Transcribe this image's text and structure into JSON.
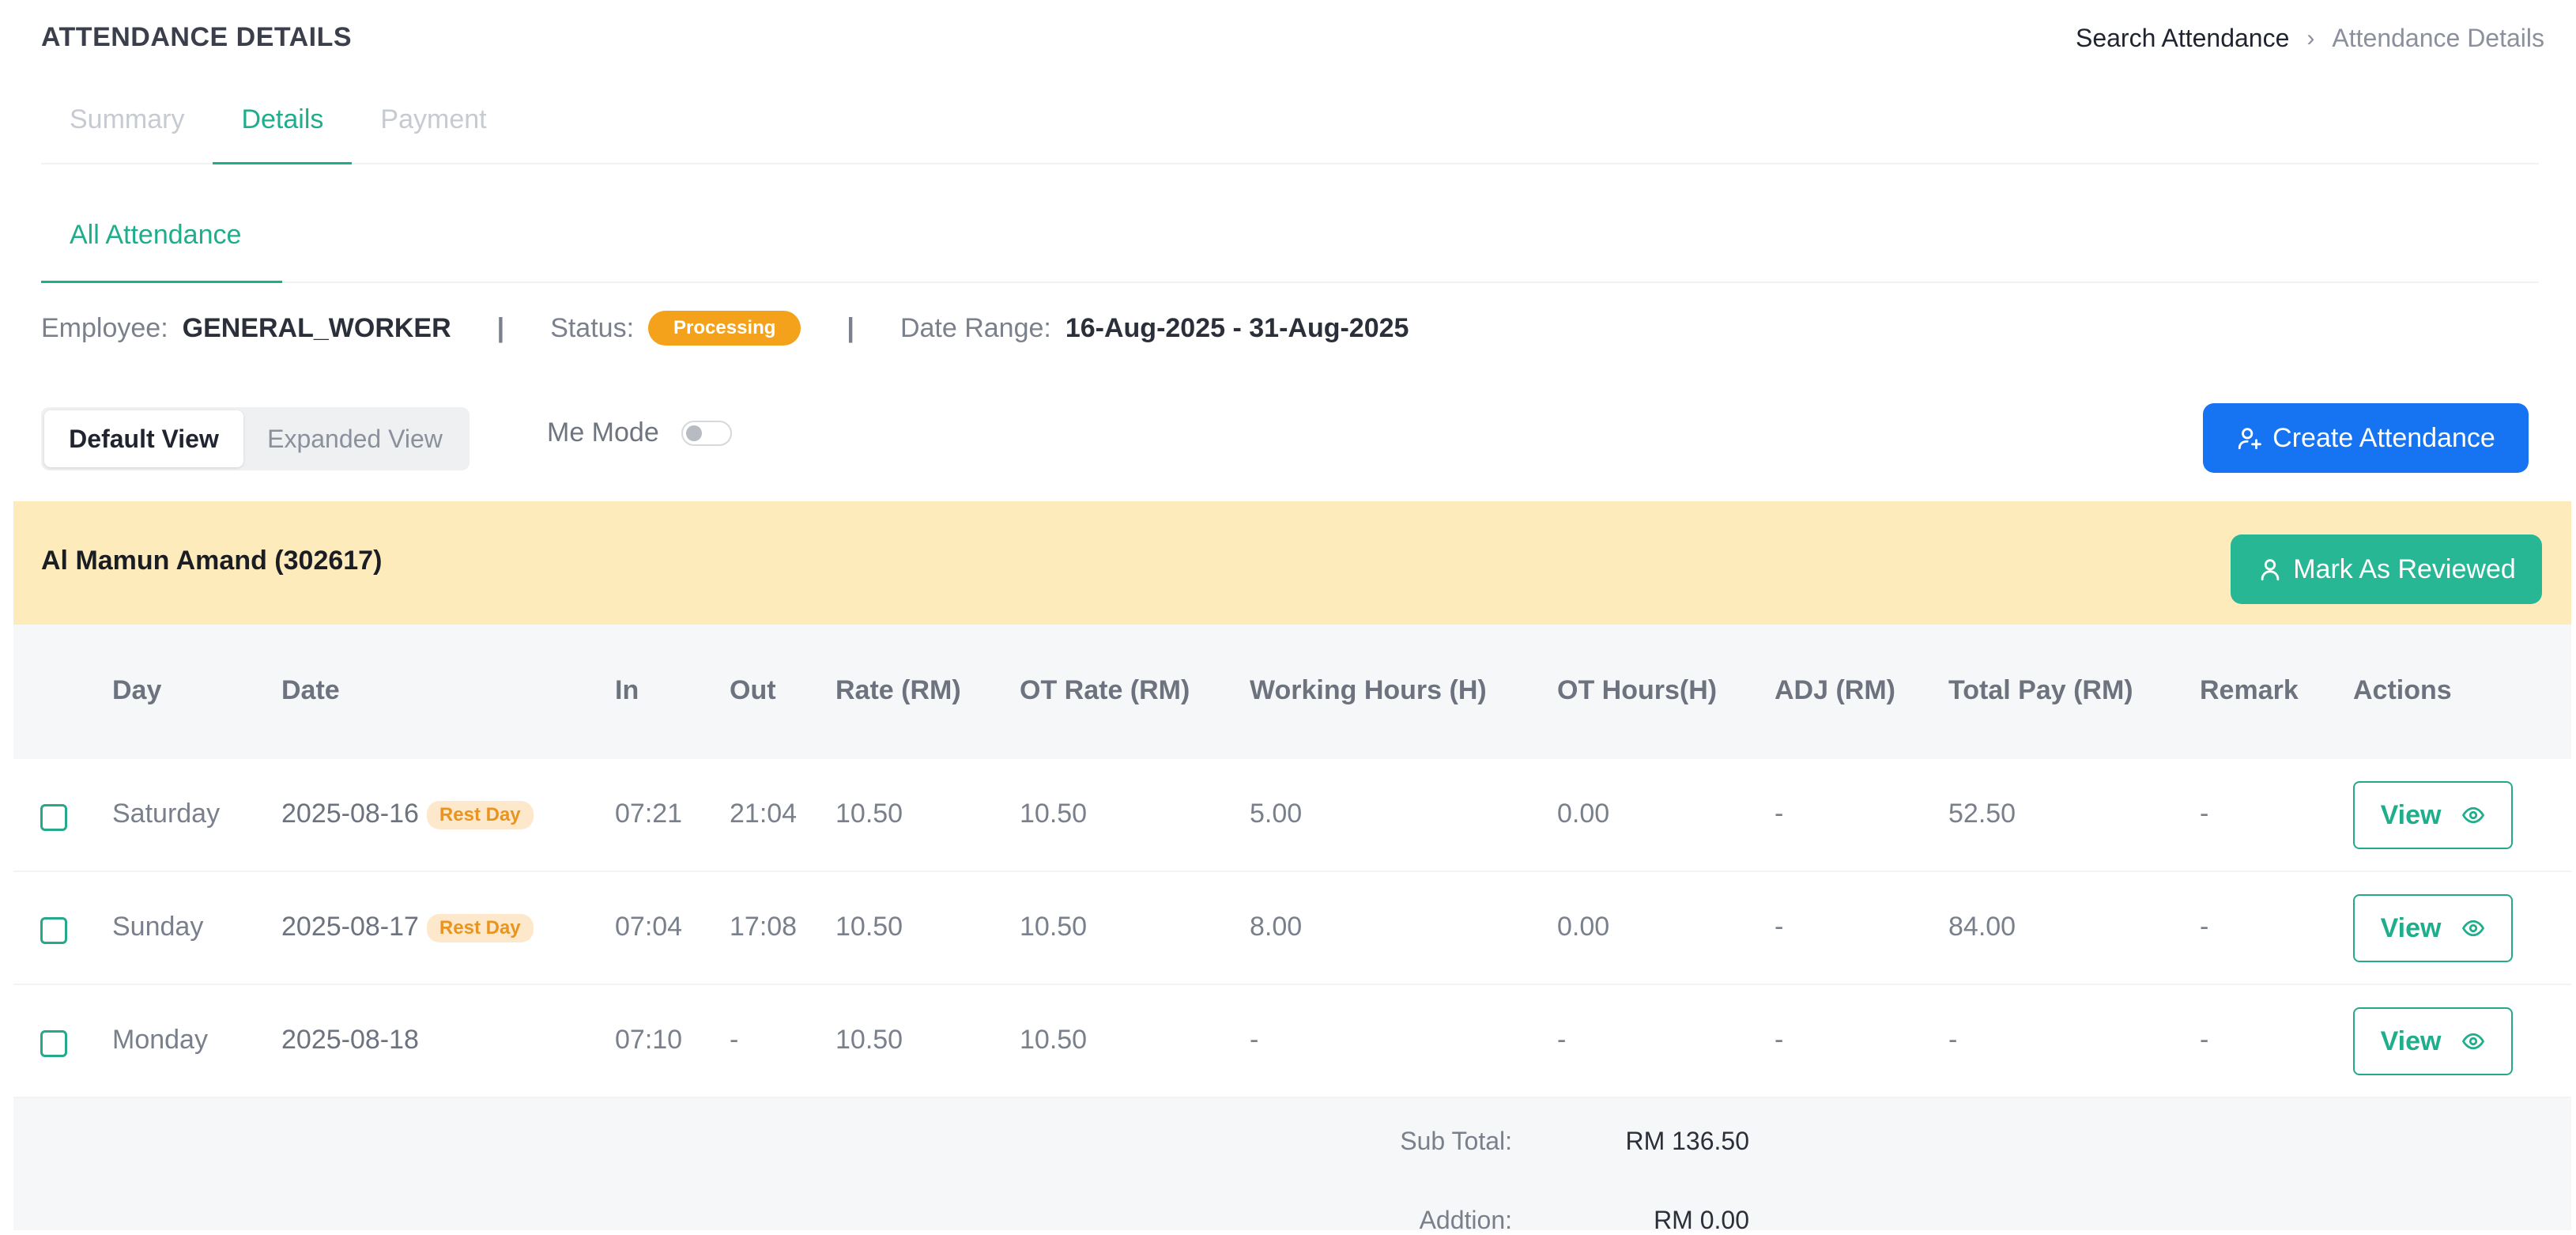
{
  "header": {
    "title": "ATTENDANCE DETAILS",
    "breadcrumb": {
      "parent": "Search Attendance",
      "separator": "›",
      "current": "Attendance Details"
    }
  },
  "tabs": [
    {
      "label": "Summary",
      "active": false
    },
    {
      "label": "Details",
      "active": true
    },
    {
      "label": "Payment",
      "active": false
    }
  ],
  "subtabs": {
    "all_attendance": "All Attendance"
  },
  "info": {
    "employee_label": "Employee:",
    "employee_value": "GENERAL_WORKER",
    "sep": "|",
    "status_label": "Status:",
    "status_value": "Processing",
    "date_range_label": "Date Range:",
    "date_range_value": "16-Aug-2025 - 31-Aug-2025"
  },
  "view_toggle": {
    "default": "Default View",
    "expanded": "Expanded View",
    "selected": "Default View"
  },
  "me_mode": {
    "label": "Me Mode",
    "enabled": false
  },
  "create_button": {
    "label": "Create Attendance",
    "icon": "user-plus-icon",
    "color": "#1673f2"
  },
  "employee_section": {
    "name": "Al Mamun Amand (302617)",
    "review_button": "Mark As Reviewed",
    "review_icon": "user-icon"
  },
  "table": {
    "headers": {
      "day": "Day",
      "date": "Date",
      "in": "In",
      "out": "Out",
      "rate": "Rate (RM)",
      "ot_rate": "OT Rate (RM)",
      "working_hours": "Working Hours (H)",
      "ot_hours": "OT Hours(H)",
      "adj": "ADJ (RM)",
      "total_pay": "Total Pay (RM)",
      "remark": "Remark",
      "actions": "Actions"
    },
    "rows": [
      {
        "day": "Saturday",
        "date": "2025-08-16",
        "badge": "Rest Day",
        "in": "07:21",
        "out": "21:04",
        "rate": "10.50",
        "ot_rate": "10.50",
        "working_hours": "5.00",
        "ot_hours": "0.00",
        "adj": "-",
        "total_pay": "52.50",
        "remark": "-",
        "action": "View"
      },
      {
        "day": "Sunday",
        "date": "2025-08-17",
        "badge": "Rest Day",
        "in": "07:04",
        "out": "17:08",
        "rate": "10.50",
        "ot_rate": "10.50",
        "working_hours": "8.00",
        "ot_hours": "0.00",
        "adj": "-",
        "total_pay": "84.00",
        "remark": "-",
        "action": "View"
      },
      {
        "day": "Monday",
        "date": "2025-08-18",
        "badge": "",
        "in": "07:10",
        "out": "-",
        "rate": "10.50",
        "ot_rate": "10.50",
        "working_hours": "-",
        "ot_hours": "-",
        "adj": "-",
        "total_pay": "-",
        "remark": "-",
        "action": "View"
      }
    ]
  },
  "footer": {
    "subtotal_label": "Sub Total:",
    "subtotal_value": "RM 136.50",
    "addition_label": "Addtion:",
    "addition_value": "RM 0.00"
  },
  "colors": {
    "accent": "#1fae8c",
    "primary": "#1673f2",
    "warning": "#f4a21b",
    "highlight": "#fdebbb"
  }
}
